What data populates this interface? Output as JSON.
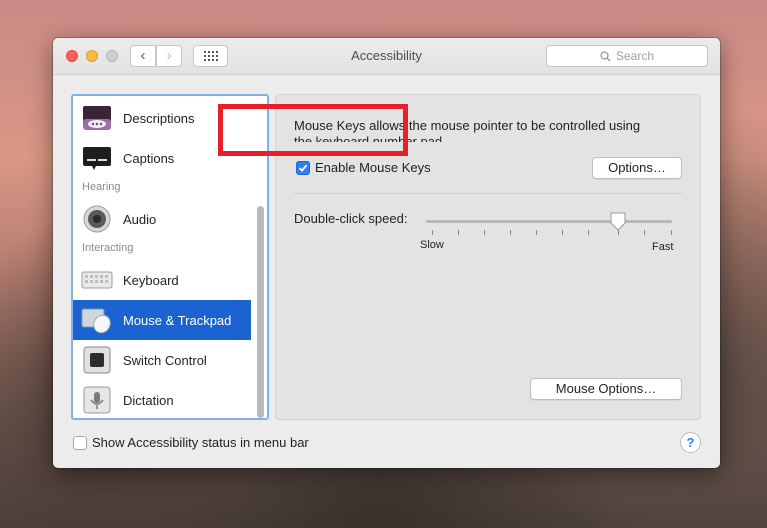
{
  "window": {
    "title": "Accessibility",
    "search_placeholder": "Search",
    "back_glyph": "‹",
    "forward_glyph": "›"
  },
  "sidebar": {
    "items": [
      {
        "label": "Descriptions",
        "icon": "descriptions-icon"
      },
      {
        "label": "Captions",
        "icon": "captions-icon"
      },
      {
        "label": "Audio",
        "icon": "speaker-icon"
      },
      {
        "label": "Keyboard",
        "icon": "keyboard-icon"
      },
      {
        "label": "Mouse & Trackpad",
        "icon": "mouse-trackpad-icon",
        "selected": true
      },
      {
        "label": "Switch Control",
        "icon": "switch-control-icon"
      },
      {
        "label": "Dictation",
        "icon": "microphone-icon"
      }
    ],
    "categories": [
      "Hearing",
      "Interacting"
    ]
  },
  "main": {
    "description": "Mouse Keys allows the mouse pointer to be controlled using",
    "description_cont": "the keyboard number pad.",
    "enable_mouse_keys": {
      "label": "Enable Mouse Keys",
      "checked": true
    },
    "options_button": "Options…",
    "double_click_speed": {
      "label": "Double-click speed:",
      "slow": "Slow",
      "fast": "Fast",
      "value": 0.8
    },
    "mouse_options_button": "Mouse Options…"
  },
  "footer": {
    "show_status": {
      "label": "Show Accessibility status in menu bar",
      "checked": false
    },
    "help": "?"
  },
  "colors": {
    "accent": "#2f7ef5",
    "selection": "#1b63d1",
    "highlight_box": "#e5202a"
  }
}
